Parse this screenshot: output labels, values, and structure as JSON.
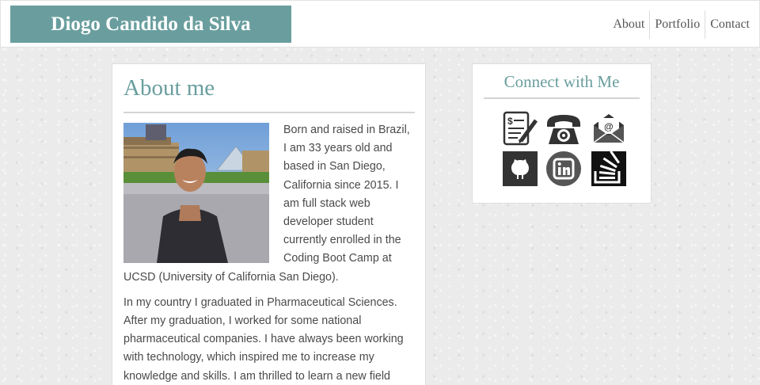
{
  "header": {
    "brand": "Diogo Candido da Silva",
    "nav": [
      "About",
      "Portfolio",
      "Contact"
    ]
  },
  "about": {
    "title": "About me",
    "photo_alt": "Photo of Diogo Candido da Silva",
    "paragraphs": [
      "Born and raised in Brazil, I am 33 years old and based in San Diego, California since 2015. I am full stack web developer student currently enrolled in the Coding Boot Camp at UCSD (University of California San Diego).",
      "In my country I graduated in Pharmaceutical Sciences. After my graduation, I worked for some national pharmaceutical companies. I have always been working with technology, which inspired me to increase my knowledge and skills. I am thrilled to learn a new field"
    ]
  },
  "connect": {
    "title": "Connect with Me",
    "icons": [
      "resume-icon",
      "phone-icon",
      "email-icon",
      "github-icon",
      "linkedin-icon",
      "stackoverflow-icon"
    ]
  },
  "colors": {
    "accent": "#6a9e9e",
    "text": "#4a4a4a",
    "icon_dark": "#333333"
  }
}
